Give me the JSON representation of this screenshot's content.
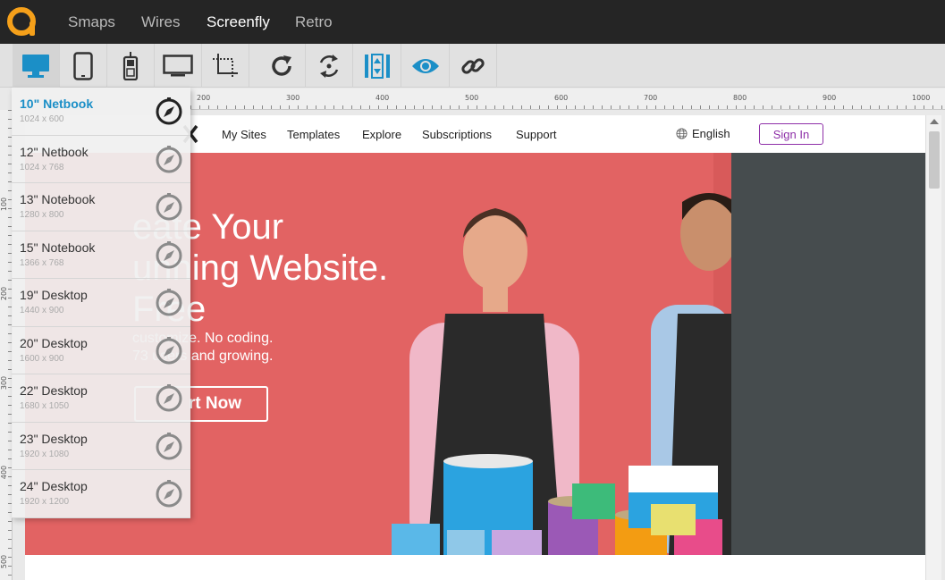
{
  "topnav": {
    "items": [
      {
        "label": "Smaps",
        "active": false
      },
      {
        "label": "Wires",
        "active": false
      },
      {
        "label": "Screenfly",
        "active": true
      },
      {
        "label": "Retro",
        "active": false
      }
    ]
  },
  "toolbar": {
    "tools": [
      "desktop-icon",
      "tablet-icon",
      "mobile-icon",
      "television-icon",
      "custom-size-icon",
      "rotate-icon",
      "scroll-sync-icon",
      "scrollbar-toggle-icon",
      "preview-icon",
      "share-link-icon"
    ],
    "active_tool": "desktop-icon",
    "accent": "#1b8fc7"
  },
  "ruler": {
    "top_ticks": [
      "200",
      "300",
      "400",
      "500",
      "600",
      "700",
      "800",
      "900",
      "1000"
    ],
    "left_ticks": [
      "100",
      "200",
      "300",
      "400",
      "500"
    ]
  },
  "devices": [
    {
      "name": "10\" Netbook",
      "size": "1024 x 600",
      "active": true
    },
    {
      "name": "12\" Netbook",
      "size": "1024 x 768",
      "active": false
    },
    {
      "name": "13\" Notebook",
      "size": "1280 x 800",
      "active": false
    },
    {
      "name": "15\" Notebook",
      "size": "1366 x 768",
      "active": false
    },
    {
      "name": "19\" Desktop",
      "size": "1440 x 900",
      "active": false
    },
    {
      "name": "20\" Desktop",
      "size": "1600 x 900",
      "active": false
    },
    {
      "name": "22\" Desktop",
      "size": "1680 x 1050",
      "active": false
    },
    {
      "name": "23\" Desktop",
      "size": "1920 x 1080",
      "active": false
    },
    {
      "name": "24\" Desktop",
      "size": "1920 x 1200",
      "active": false
    }
  ],
  "site": {
    "nav": [
      "My Sites",
      "Templates",
      "Explore",
      "Subscriptions",
      "Support"
    ],
    "language": "English",
    "sign_in": "Sign In",
    "hero_title": "eate Your\nunning Website.\nFree",
    "hero_subtitle": "customize. No coding.\n73 users and growing.",
    "hero_button": "rt Now",
    "hero_color": "#e26363",
    "brand_color": "#8e2fa8"
  }
}
